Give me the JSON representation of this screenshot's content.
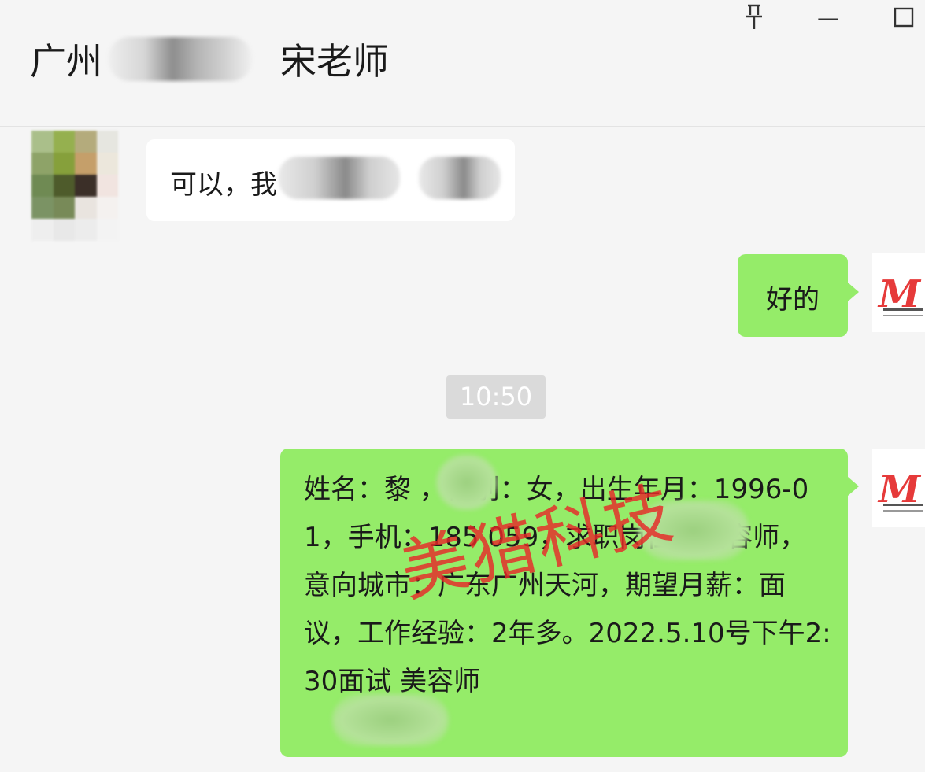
{
  "header": {
    "title_prefix": "广州",
    "title_suffix": "宋老师",
    "controls": {
      "pin": "pin-icon",
      "minimize_symbol": "—",
      "maximize": "maximize-icon"
    }
  },
  "messages": {
    "incoming_1": {
      "text": "可以，我"
    },
    "outgoing_1": {
      "text": "好的"
    },
    "timestamp": "10:50",
    "outgoing_2": {
      "text": "姓名：黎 ，性别：女，出生年月：1996-01，手机：185 059，求职岗位：美容师，意向城市：广东广州天河，期望月薪：面议，工作经验：2年多。2022.5.10号下午2:30面试 美容师"
    }
  },
  "watermark": "美猎科技",
  "colors": {
    "background": "#f5f5f5",
    "bubble_out": "#95ec69",
    "bubble_in": "#ffffff",
    "timestamp_bg": "#dadada",
    "watermark": "#e62828"
  }
}
